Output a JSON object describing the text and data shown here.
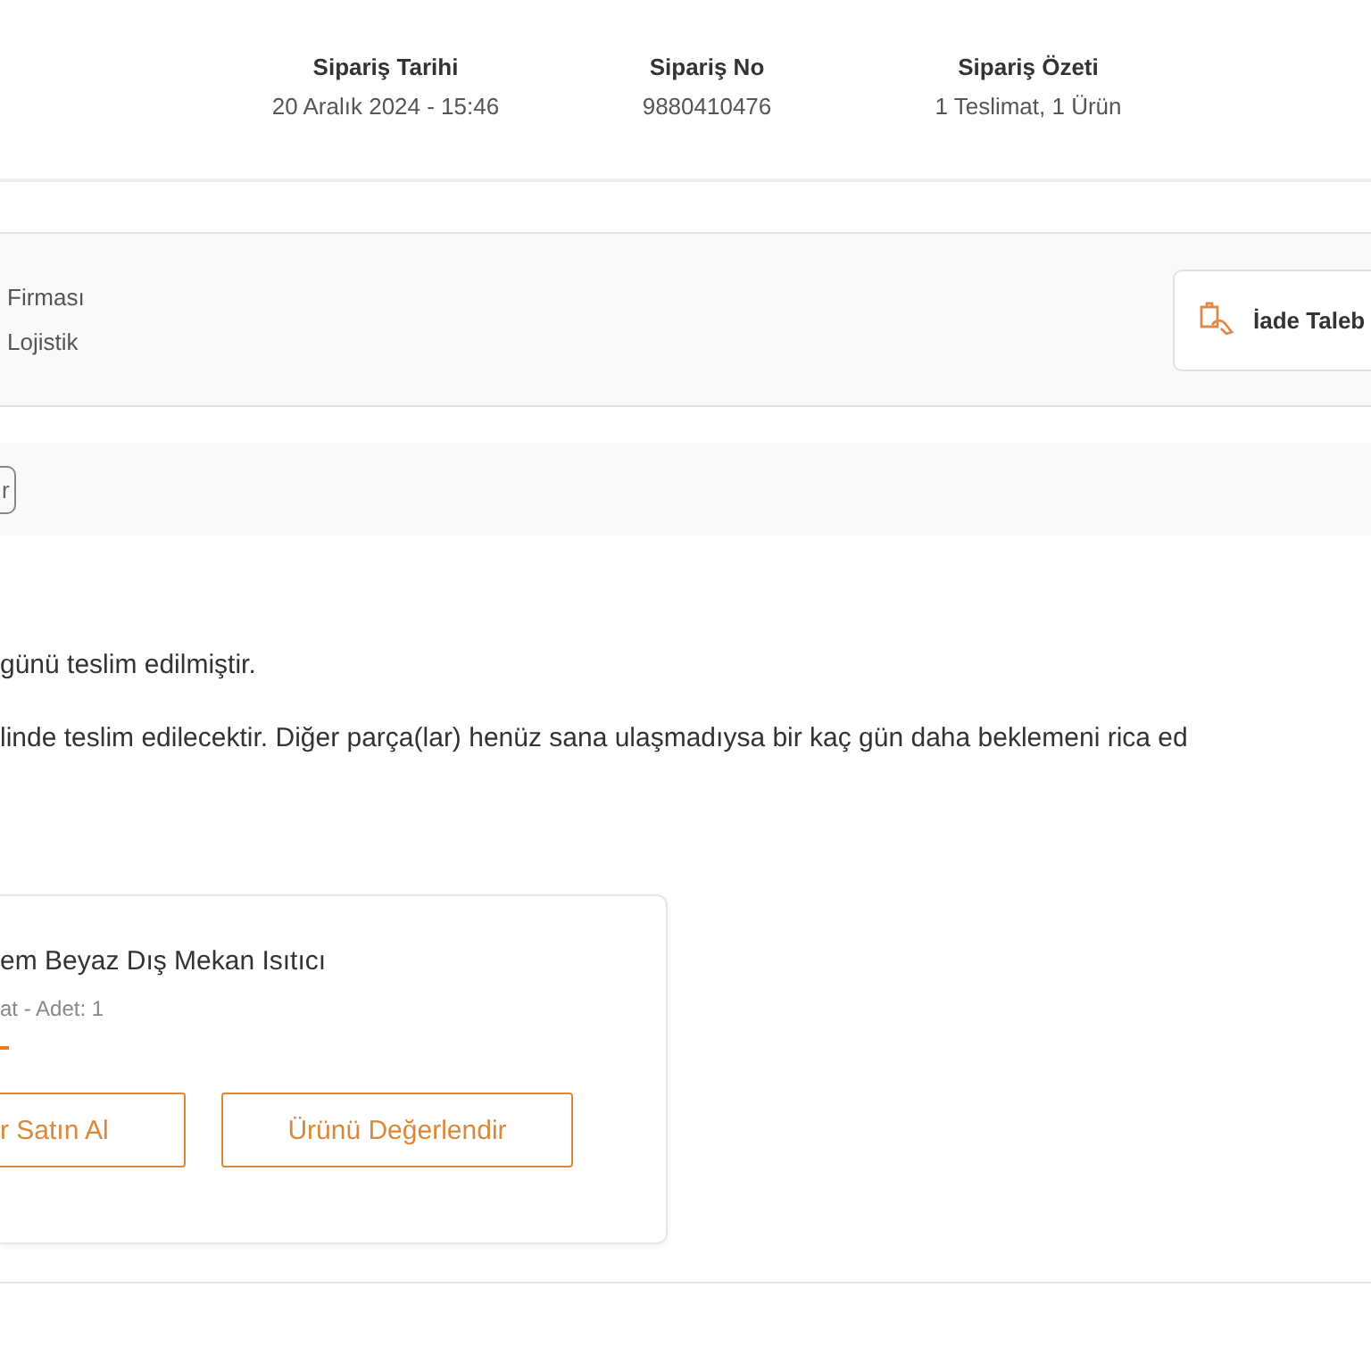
{
  "order_summary": [
    {
      "label": "Sipariş Tarihi",
      "value": "20 Aralık 2024 - 15:46"
    },
    {
      "label": "Sipariş No",
      "value": "9880410476"
    },
    {
      "label": "Sipariş Özeti",
      "value": "1 Teslimat, 1 Ürün"
    }
  ],
  "shipment": {
    "carrier_label": "Firması",
    "carrier_name": "Lojistik",
    "return_button": "İade Taleb"
  },
  "status_tag": "r",
  "messages": [
    "günü teslim edilmiştir.",
    "linde teslim edilecektir. Diğer parça(lar) henüz sana ulaşmadıysa bir kaç gün daha beklemeni rica ed"
  ],
  "product": {
    "name": "em Beyaz Dış Mekan Isıtıcı",
    "details": "at - Adet: 1",
    "buttons": [
      "r Satın Al",
      "Ürünü Değerlendir"
    ]
  }
}
